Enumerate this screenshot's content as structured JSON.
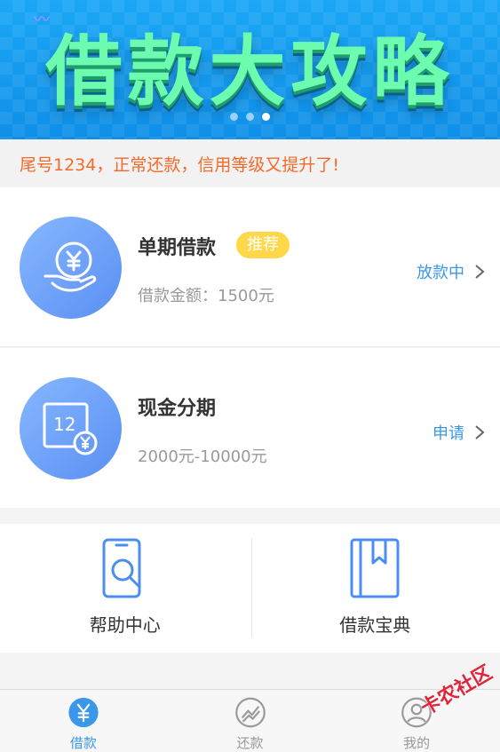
{
  "banner": {
    "title": "借款大攻略",
    "slides": 3,
    "active_slide": 3
  },
  "notice": {
    "text": "尾号1234，正常还款，信用等级又提升了!"
  },
  "loans": [
    {
      "title": "单期借款",
      "badge": "推荐",
      "subtitle": "借款金额：1500元",
      "action": "放款中",
      "icon": "yuan-hand-icon"
    },
    {
      "title": "现金分期",
      "subtitle": "2000元-10000元",
      "action": "申请",
      "icon": "calendar-yuan-icon",
      "calendar_number": "12"
    }
  ],
  "quick_links": [
    {
      "label": "帮助中心",
      "icon": "phone-search-icon"
    },
    {
      "label": "借款宝典",
      "icon": "bookmark-book-icon"
    }
  ],
  "tabs": [
    {
      "label": "借款",
      "icon": "yuan-icon",
      "active": true
    },
    {
      "label": "还款",
      "icon": "trend-icon",
      "active": false
    },
    {
      "label": "我的",
      "icon": "user-icon",
      "active": false
    }
  ],
  "watermark": "卡农社区",
  "colors": {
    "accent": "#3a97ea",
    "notice": "#f56a2a",
    "badge": "#ffd84a"
  }
}
